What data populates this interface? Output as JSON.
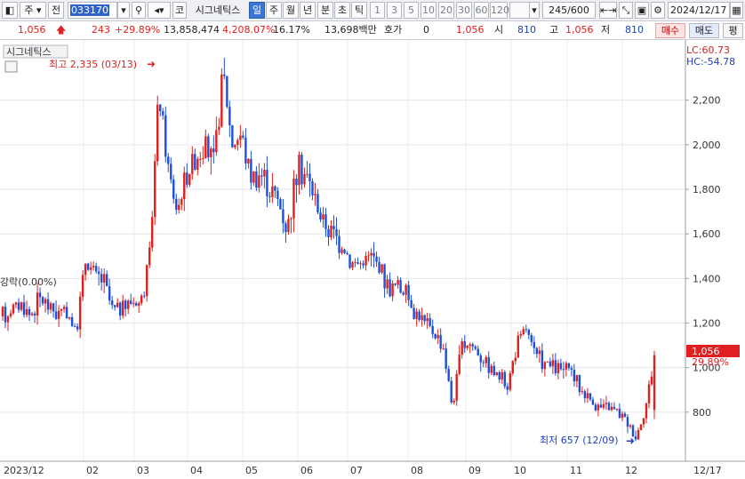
{
  "toolbar": {
    "market": "주",
    "prev": "전",
    "code": "033170",
    "exchange": "코",
    "name": "시그네틱스",
    "periods": [
      "일",
      "주",
      "월",
      "년",
      "분",
      "초",
      "틱"
    ],
    "intervals": [
      "1",
      "3",
      "5",
      "10",
      "20",
      "30",
      "60",
      "120"
    ],
    "count": "245/600",
    "date": "2024/12/17"
  },
  "quote": {
    "price": "1,056",
    "change": "243",
    "change_pct": "+29.89%",
    "volume": "13,858,474",
    "volume_ratio": "4,208.07%",
    "turnover": "16.17%",
    "amount": "13,698백만",
    "bid_label": "호가",
    "bid_value": "0",
    "bid_price": "1,056",
    "open_label": "시",
    "open": "810",
    "high_label": "고",
    "high": "1,056",
    "low_label": "저",
    "low": "810",
    "buy_label": "매수",
    "sell_label": "매도",
    "eval_label": "평"
  },
  "chart_data": {
    "type": "candlestick",
    "title": "시그네틱스",
    "y_ticks": [
      800,
      1000,
      1200,
      1400,
      1600,
      1800,
      2000,
      2200
    ],
    "y_tick_labels": [
      "800",
      "1,000",
      "1,200",
      "1,400",
      "1,600",
      "1,800",
      "2,000",
      "2,200"
    ],
    "ylim": [
      580,
      2470
    ],
    "x_tick_labels": [
      "2023/12",
      "02",
      "03",
      "04",
      "05",
      "06",
      "07",
      "08",
      "09",
      "10",
      "11",
      "12",
      "12/17"
    ],
    "lc_label": "LC:60.73",
    "hc_label": "HC:-54.78",
    "left_label": "강락(0.00%)",
    "high_annotation": "최고 2,335 (03/13)",
    "low_annotation": "최저 657 (12/09)",
    "last_price": "1,056",
    "last_change": "29.89%",
    "series": [
      {
        "values": [
          1230,
          1270,
          1285,
          1235,
          1310,
          1280,
          1240,
          1260,
          1150,
          1480,
          1420,
          1390,
          1250,
          1270,
          1300,
          1290,
          1480,
          2230,
          1900,
          1700,
          1860,
          1950,
          2000,
          1900,
          2335,
          2000,
          2050,
          1860,
          1880,
          1820,
          1750,
          1620,
          1880,
          1870,
          1760,
          1650,
          1600,
          1560,
          1470,
          1470,
          1500,
          1460,
          1360,
          1370,
          1330,
          1250,
          1200,
          1160,
          1100,
          820,
          1100,
          1110,
          1060,
          1010,
          960,
          920,
          1100,
          1180,
          1050,
          1020,
          1000,
          990,
          980,
          900,
          860,
          820,
          820,
          800,
          760,
          690,
          810,
          1056
        ]
      }
    ]
  }
}
